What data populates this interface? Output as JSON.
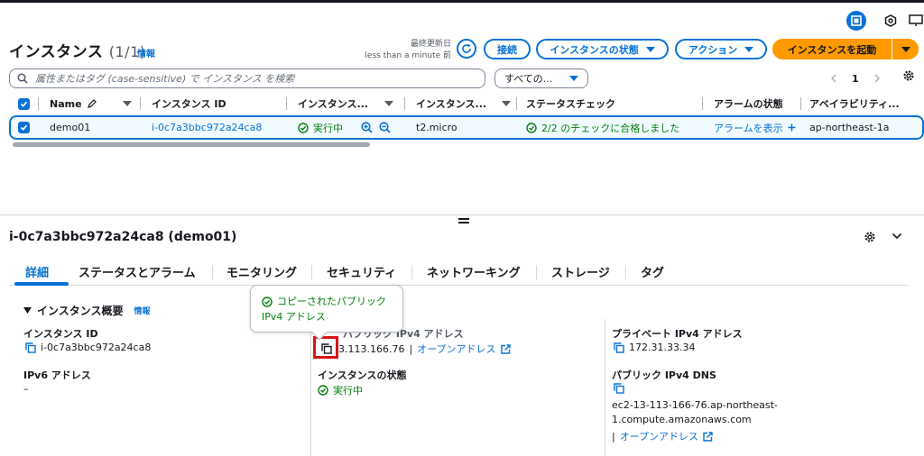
{
  "topbar": {
    "icons": [
      "cloudshell-square-icon",
      "settings-hex-icon",
      "monitor-icon"
    ]
  },
  "instances": {
    "title": "インスタンス",
    "count": "(1/1)",
    "info_link": "情報",
    "last_updated_label": "最終更新日",
    "last_updated_value": "less than a minute 前",
    "connect_label": "接続",
    "instance_state_label": "インスタンスの状態",
    "actions_label": "アクション",
    "launch_label": "インスタンスを起動",
    "search_placeholder": "属性またはタグ (case-sensitive) で インスタンス を検索",
    "state_filter_value": "すべての...",
    "page_number": "1"
  },
  "table": {
    "columns": [
      "Name",
      "インスタンス ID",
      "インスタンス...",
      "インスタンス...",
      "ステータスチェック",
      "アラームの状態",
      "アベイラビリティ..."
    ],
    "row": {
      "name": "demo01",
      "instance_id": "i-0c7a3bbc972a24ca8",
      "state": "実行中",
      "type": "t2.micro",
      "status_check": "2/2 のチェックに合格しました",
      "alarm": "アラームを表示",
      "az": "ap-northeast-1a"
    }
  },
  "detail": {
    "title": "i-0c7a3bbc972a24ca8 (demo01)",
    "tabs": [
      "詳細",
      "ステータスとアラーム",
      "モニタリング",
      "セキュリティ",
      "ネットワーキング",
      "ストレージ",
      "タグ"
    ],
    "summary_title": "インスタンス概要",
    "summary_info": "情報",
    "fields": {
      "instance_id_label": "インスタンス ID",
      "instance_id_value": "i-0c7a3bbc972a24ca8",
      "ipv6_label": "IPv6 アドレス",
      "ipv6_value": "–",
      "public_ipv4_label": "パブリック IPv4 アドレス",
      "public_ipv4_value": "3.113.166.76",
      "open_address": "オープンアドレス",
      "state_label": "インスタンスの状態",
      "state_value": "実行中",
      "private_ipv4_label": "プライベート IPv4 アドレス",
      "private_ipv4_value": "172.31.33.34",
      "public_dns_label": "パブリック IPv4 DNS",
      "public_dns_line1": "ec2-13-113-166-76.ap-northeast-",
      "public_dns_line2": "1.compute.amazonaws.com",
      "public_dns_open": "オープンアドレス"
    },
    "tooltip_line1": "コピーされたパブリック",
    "tooltip_line2": "IPv4 アドレス"
  },
  "colors": {
    "accent": "#0972d3",
    "launch": "#ff9900",
    "success": "#037f0c",
    "highlight": "#d91515"
  }
}
